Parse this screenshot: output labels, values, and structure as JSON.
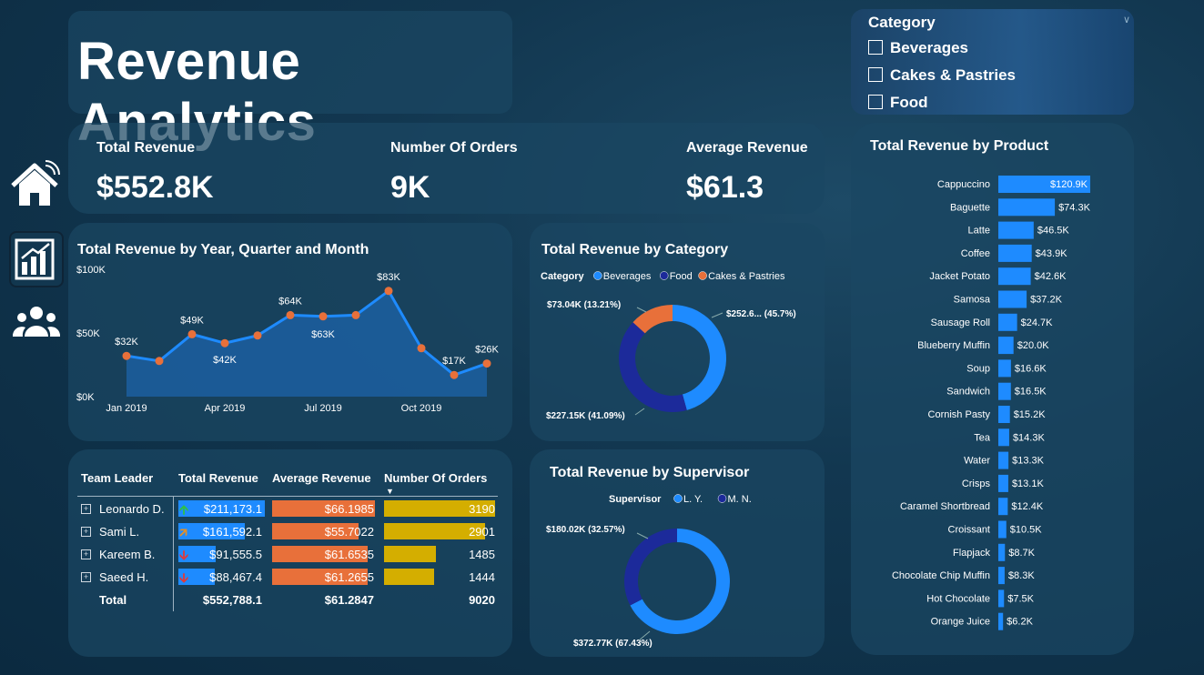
{
  "title": "Revenue Analytics",
  "nav": [
    {
      "name": "home-icon"
    },
    {
      "name": "bar-chart-icon"
    },
    {
      "name": "people-icon"
    }
  ],
  "kpis": [
    {
      "label": "Total Revenue",
      "value": "$552.8K"
    },
    {
      "label": "Number Of Orders",
      "value": "9K"
    },
    {
      "label": "Average Revenue",
      "value": "$61.3"
    }
  ],
  "slicer": {
    "header": "Category",
    "options": [
      "Beverages",
      "Cakes & Pastries",
      "Food"
    ]
  },
  "colors": {
    "accent": "#1e8bff",
    "orange": "#e8703a",
    "navy": "#1c2a9a",
    "gold": "#d4ae00"
  },
  "line_chart": {
    "title": "Total Revenue by Year, Quarter and Month",
    "chart_data": {
      "type": "area",
      "x": [
        "Jan 2019",
        "Feb 2019",
        "Mar 2019",
        "Apr 2019",
        "May 2019",
        "Jun 2019",
        "Jul 2019",
        "Aug 2019",
        "Sep 2019",
        "Oct 2019",
        "Nov 2019",
        "Dec 2019"
      ],
      "values": [
        32,
        28,
        49,
        42,
        48,
        64,
        63,
        64,
        83,
        38,
        17,
        26
      ],
      "data_labels": [
        "$32K",
        "",
        "$49K",
        "$42K",
        "",
        "$64K",
        "$63K",
        "",
        "$83K",
        "",
        "$17K",
        "$26K"
      ],
      "x_ticks": [
        "Jan 2019",
        "Apr 2019",
        "Jul 2019",
        "Oct 2019"
      ],
      "y_ticks": [
        "$0K",
        "$50K",
        "$100K"
      ],
      "ylim": [
        0,
        100
      ]
    }
  },
  "category_donut": {
    "title": "Total Revenue by Category",
    "legend_title": "Category",
    "chart_data": {
      "type": "pie",
      "categories": [
        "Beverages",
        "Food",
        "Cakes & Pastries"
      ],
      "values": [
        252.6,
        227.15,
        73.04
      ],
      "labels": [
        "$252.6... (45.7%)",
        "$227.15K (41.09%)",
        "$73.04K (13.21%)"
      ]
    }
  },
  "supervisor_donut": {
    "title": "Total Revenue by Supervisor",
    "legend_title": "Supervisor",
    "chart_data": {
      "type": "pie",
      "categories": [
        "L. Y.",
        "M. N."
      ],
      "values": [
        372.77,
        180.02
      ],
      "labels": [
        "$372.77K (67.43%)",
        "$180.02K (32.57%)"
      ]
    }
  },
  "product_bars": {
    "title": "Total Revenue by Product",
    "chart_data": {
      "type": "bar",
      "categories": [
        "Cappuccino",
        "Baguette",
        "Latte",
        "Coffee",
        "Jacket Potato",
        "Samosa",
        "Sausage Roll",
        "Blueberry Muffin",
        "Soup",
        "Sandwich",
        "Cornish Pasty",
        "Tea",
        "Water",
        "Crisps",
        "Caramel Shortbread",
        "Croissant",
        "Flapjack",
        "Chocolate Chip Muffin",
        "Hot Chocolate",
        "Orange Juice"
      ],
      "values": [
        120.9,
        74.3,
        46.5,
        43.9,
        42.6,
        37.2,
        24.7,
        20.0,
        16.6,
        16.5,
        15.2,
        14.3,
        13.3,
        13.1,
        12.4,
        10.5,
        8.7,
        8.3,
        7.5,
        6.2
      ],
      "labels": [
        "$120.9K",
        "$74.3K",
        "$46.5K",
        "$43.9K",
        "$42.6K",
        "$37.2K",
        "$24.7K",
        "$20.0K",
        "$16.6K",
        "$16.5K",
        "$15.2K",
        "$14.3K",
        "$13.3K",
        "$13.1K",
        "$12.4K",
        "$10.5K",
        "$8.7K",
        "$8.3K",
        "$7.5K",
        "$6.2K"
      ]
    }
  },
  "table": {
    "headers": [
      "Team Leader",
      "Total Revenue",
      "Average Revenue",
      "Number Of Orders"
    ],
    "rows": [
      {
        "name": "Leonardo D.",
        "total": "$211,173.1",
        "avg": "$66.1985",
        "orders": "3190",
        "trend": "up",
        "total_v": 211173.1,
        "avg_v": 66.1985,
        "orders_v": 3190
      },
      {
        "name": "Sami L.",
        "total": "$161,592.1",
        "avg": "$55.7022",
        "orders": "2901",
        "trend": "up-right",
        "total_v": 161592.1,
        "avg_v": 55.7022,
        "orders_v": 2901
      },
      {
        "name": "Kareem B.",
        "total": "$91,555.5",
        "avg": "$61.6535",
        "orders": "1485",
        "trend": "down",
        "total_v": 91555.5,
        "avg_v": 61.6535,
        "orders_v": 1485
      },
      {
        "name": "Saeed H.",
        "total": "$88,467.4",
        "avg": "$61.2655",
        "orders": "1444",
        "trend": "down",
        "total_v": 88467.4,
        "avg_v": 61.2655,
        "orders_v": 1444
      }
    ],
    "total_row": {
      "label": "Total",
      "total": "$552,788.1",
      "avg": "$61.2847",
      "orders": "9020"
    }
  }
}
